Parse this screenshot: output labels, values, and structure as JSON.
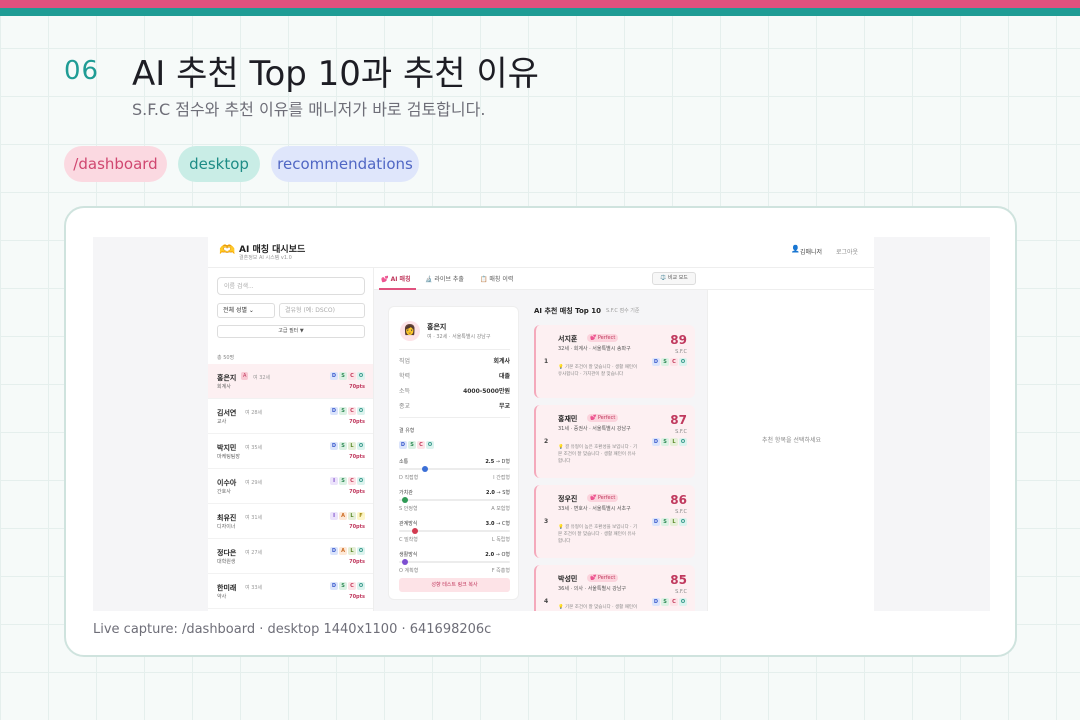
{
  "slide": {
    "number": "06",
    "title": "AI 추천 Top 10과 추천 이유",
    "subtitle": "S.F.C 점수와 추천 이유를 매니저가 바로 검토합니다.",
    "tags": [
      "/dashboard",
      "desktop",
      "recommendations"
    ],
    "caption": "Live capture: /dashboard · desktop 1440x1100 · 641698206c"
  },
  "app": {
    "logo_icon": "🫶",
    "title": "AI 매칭 대시보드",
    "subtitle": "결혼정보 AI 시스템 v1.0",
    "user_icon": "👤",
    "user": "김매니저",
    "logout": "로그아웃",
    "sidebar": {
      "search_placeholder": "이름 검색...",
      "gender_select": "전체 성별 ⌄",
      "type_placeholder": "결유형 (예: DSCO)",
      "advanced_filter": "고급 필터 ▼",
      "total": "총 50명",
      "members": [
        {
          "name": "홍은지",
          "flag": "A",
          "meta": "여 32세",
          "job": "회계사",
          "type": [
            "D",
            "S",
            "C",
            "O"
          ],
          "pts": "70pts"
        },
        {
          "name": "김서연",
          "meta": "여 28세",
          "job": "교사",
          "type": [
            "D",
            "S",
            "C",
            "O"
          ],
          "pts": "70pts"
        },
        {
          "name": "박지민",
          "meta": "여 35세",
          "job": "마케팅팀장",
          "type": [
            "D",
            "S",
            "L",
            "O"
          ],
          "pts": "70pts"
        },
        {
          "name": "이수아",
          "meta": "여 29세",
          "job": "간호사",
          "type": [
            "I",
            "S",
            "C",
            "O"
          ],
          "pts": "70pts"
        },
        {
          "name": "최유진",
          "meta": "여 31세",
          "job": "디자이너",
          "type": [
            "I",
            "A",
            "L",
            "F"
          ],
          "pts": "70pts"
        },
        {
          "name": "정다은",
          "meta": "여 27세",
          "job": "대학원생",
          "type": [
            "D",
            "A",
            "L",
            "O"
          ],
          "pts": "70pts"
        },
        {
          "name": "한미래",
          "meta": "여 33세",
          "job": "약사",
          "type": [
            "D",
            "S",
            "C",
            "O"
          ],
          "pts": "70pts"
        }
      ]
    },
    "tabs": [
      {
        "icon": "💕",
        "label": "AI 매칭"
      },
      {
        "icon": "🔬",
        "label": "라이브 추출"
      },
      {
        "icon": "📋",
        "label": "매칭 이력"
      }
    ],
    "compare_button": "⚖️ 비교 모드",
    "profile": {
      "avatar": "👩",
      "name": "홍은지",
      "meta": "여 · 32세 · 서울특별시 강남구",
      "rows": [
        {
          "label": "직업",
          "value": "회계사"
        },
        {
          "label": "학력",
          "value": "대졸"
        },
        {
          "label": "소득",
          "value": "4000-5000만원"
        },
        {
          "label": "종교",
          "value": "무교"
        }
      ],
      "type_label": "결 유형",
      "type": [
        "D",
        "S",
        "C",
        "O"
      ],
      "axes": [
        {
          "name": "소통",
          "score": "2.5",
          "to": "D형",
          "left": "D 직접형",
          "right": "I 간접형",
          "value": 0.2,
          "color": "#3b6fd6"
        },
        {
          "name": "가치관",
          "score": "2.0",
          "to": "S형",
          "left": "S 안정형",
          "right": "A 모험형",
          "value": 0.0,
          "color": "#2f9a55"
        },
        {
          "name": "관계방식",
          "score": "3.0",
          "to": "C형",
          "left": "C 밀착형",
          "right": "L 독립형",
          "value": 0.1,
          "color": "#d23a50"
        },
        {
          "name": "생활방식",
          "score": "2.0",
          "to": "O형",
          "left": "O 계획형",
          "right": "F 즉흥형",
          "value": 0.0,
          "color": "#7d4fd1"
        }
      ],
      "copy_button": "성향 테스트 링크 복사"
    },
    "recommendations": {
      "title": "AI 추천 매칭 Top 10",
      "subtitle": "S.F.C 점수 기준",
      "items": [
        {
          "rank": "1",
          "name": "서지훈",
          "tag": "💕 Perfect",
          "meta": "32세 · 회계사 · 서울특별시 송파구",
          "reason": "💡 기본 조건이 잘 맞습니다 · 생활 패턴이 유사합니다 · 가치관이 잘 맞습니다",
          "score": "89",
          "sfc": "S.F.C",
          "type": [
            "D",
            "S",
            "C",
            "O"
          ]
        },
        {
          "rank": "2",
          "name": "홍재민",
          "tag": "💕 Perfect",
          "meta": "31세 · 증권사 · 서울특별시 강남구",
          "reason": "💡 결 유형이 높은 호환성을 보입니다 · 기본 조건이 잘 맞습니다 · 생활 패턴이 유사합니다",
          "score": "87",
          "sfc": "S.F.C",
          "type": [
            "D",
            "S",
            "L",
            "O"
          ]
        },
        {
          "rank": "3",
          "name": "정우진",
          "tag": "💕 Perfect",
          "meta": "33세 · 변호사 · 서울특별시 서초구",
          "reason": "💡 결 유형이 높은 호환성을 보입니다 · 기본 조건이 잘 맞습니다 · 생활 패턴이 유사합니다",
          "score": "86",
          "sfc": "S.F.C",
          "type": [
            "D",
            "S",
            "L",
            "O"
          ]
        },
        {
          "rank": "4",
          "name": "박성민",
          "tag": "💕 Perfect",
          "meta": "36세 · 의사 · 서울특별시 강남구",
          "reason": "💡 기본 조건이 잘 맞습니다 · 생활 패턴이",
          "score": "85",
          "sfc": "S.F.C",
          "type": [
            "D",
            "S",
            "C",
            "O"
          ]
        }
      ]
    },
    "empty_message": "추천 항목을 선택하세요"
  }
}
